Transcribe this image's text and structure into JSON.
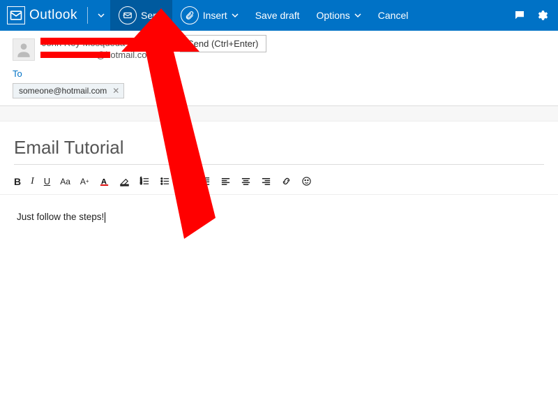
{
  "topbar": {
    "app_name": "Outlook",
    "send_label": "Send",
    "insert_label": "Insert",
    "save_draft_label": "Save draft",
    "options_label": "Options",
    "cancel_label": "Cancel"
  },
  "tooltip": {
    "text": "Send (Ctrl+Enter)"
  },
  "from": {
    "name": "John Rey Mosqueda",
    "email_suffix": "@hotmail.com"
  },
  "to": {
    "label": "To",
    "chips": [
      {
        "address": "someone@hotmail.com"
      }
    ]
  },
  "subject": {
    "value": "Email Tutorial"
  },
  "format_bar": {
    "bold": "B",
    "italic": "I",
    "underline": "U",
    "font_family": "Aa",
    "font_size": "A",
    "sup": "+"
  },
  "body": {
    "text": "Just follow the steps!"
  }
}
